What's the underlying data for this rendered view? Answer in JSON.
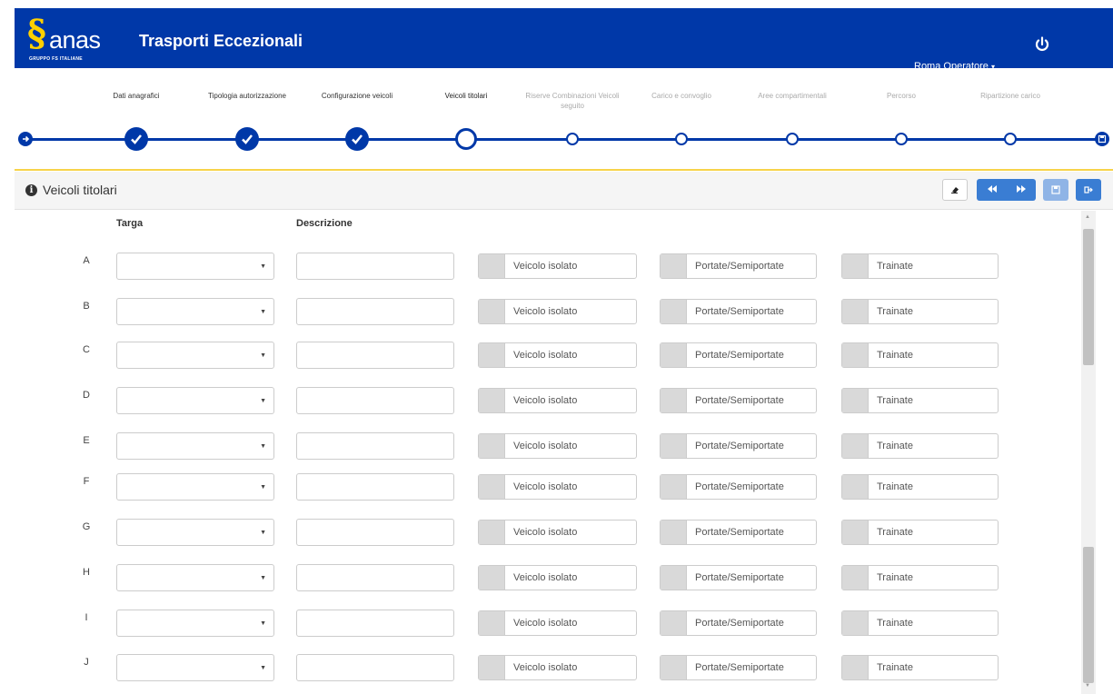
{
  "header": {
    "logo_word": "anas",
    "logo_sub": "GRUPPO FS ITALIANE",
    "app_title": "Trasporti Eccezionali",
    "user_name": "Roma Operatore",
    "brand_color": "#0038a8",
    "accent_color": "#ffd000"
  },
  "wizard": {
    "steps": [
      {
        "label": "Dati anagrafici",
        "state": "done"
      },
      {
        "label": "Tipologia autorizzazione",
        "state": "done"
      },
      {
        "label": "Configurazione veicoli",
        "state": "done"
      },
      {
        "label": "Veicoli titolari",
        "state": "current"
      },
      {
        "label": "Riserve Combinazioni Veicoli seguito",
        "state": "future"
      },
      {
        "label": "Carico e convoglio",
        "state": "future"
      },
      {
        "label": "Aree compartimentali",
        "state": "future"
      },
      {
        "label": "Percorso",
        "state": "future"
      },
      {
        "label": "Ripartizione carico",
        "state": "future"
      }
    ],
    "start_icon": "arrow-right-icon",
    "end_icon": "save-icon"
  },
  "panel": {
    "title": "Veicoli titolari",
    "toolbar_icons": [
      "clear-icon",
      "backward-icon",
      "forward-icon",
      "save-icon",
      "exit-icon"
    ]
  },
  "table": {
    "headers": {
      "targa": "Targa",
      "descrizione": "Descrizione"
    },
    "rows": [
      {
        "letter": "A",
        "targa": "",
        "descrizione": "",
        "isolato": "Veicolo isolato",
        "portate": "Portate/Semiportate",
        "trainate": "Trainate"
      },
      {
        "letter": "B",
        "targa": "",
        "descrizione": "",
        "isolato": "Veicolo isolato",
        "portate": "Portate/Semiportate",
        "trainate": "Trainate"
      },
      {
        "letter": "C",
        "targa": "",
        "descrizione": "",
        "isolato": "Veicolo isolato",
        "portate": "Portate/Semiportate",
        "trainate": "Trainate"
      },
      {
        "letter": "D",
        "targa": "",
        "descrizione": "",
        "isolato": "Veicolo isolato",
        "portate": "Portate/Semiportate",
        "trainate": "Trainate"
      },
      {
        "letter": "E",
        "targa": "",
        "descrizione": "",
        "isolato": "Veicolo isolato",
        "portate": "Portate/Semiportate",
        "trainate": "Trainate"
      },
      {
        "letter": "F",
        "targa": "",
        "descrizione": "",
        "isolato": "Veicolo isolato",
        "portate": "Portate/Semiportate",
        "trainate": "Trainate"
      },
      {
        "letter": "G",
        "targa": "",
        "descrizione": "",
        "isolato": "Veicolo isolato",
        "portate": "Portate/Semiportate",
        "trainate": "Trainate"
      },
      {
        "letter": "H",
        "targa": "",
        "descrizione": "",
        "isolato": "Veicolo isolato",
        "portate": "Portate/Semiportate",
        "trainate": "Trainate"
      },
      {
        "letter": "I",
        "targa": "",
        "descrizione": "",
        "isolato": "Veicolo isolato",
        "portate": "Portate/Semiportate",
        "trainate": "Trainate"
      },
      {
        "letter": "J",
        "targa": "",
        "descrizione": "",
        "isolato": "Veicolo isolato",
        "portate": "Portate/Semiportate",
        "trainate": "Trainate"
      }
    ]
  }
}
